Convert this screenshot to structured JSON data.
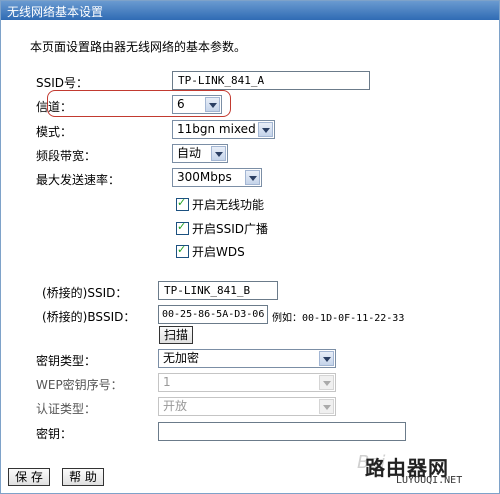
{
  "window": {
    "title": "无线网络基本设置"
  },
  "intro": "本页面设置路由器无线网络的基本参数。",
  "ssid": {
    "label": "SSID号：",
    "value": "TP-LINK_841_A"
  },
  "channel": {
    "label": "信道：",
    "value": "6"
  },
  "mode": {
    "label": "模式：",
    "value": "11bgn mixed"
  },
  "bandwidth": {
    "label": "频段带宽：",
    "value": "自动"
  },
  "max_rate": {
    "label": "最大发送速率：",
    "value": "300Mbps"
  },
  "options": {
    "wireless": "开启无线功能",
    "ssid_broadcast": "开启SSID广播",
    "wds": "开启WDS"
  },
  "bridge": {
    "ssid_label": "(桥接的)SSID：",
    "ssid_value": "TP-LINK_841_B",
    "bssid_label": "(桥接的)BSSID：",
    "bssid_value": "00-25-86-5A-D3-06",
    "bssid_example": "例如：00-1D-0F-11-22-33",
    "scan_button": "扫描"
  },
  "security": {
    "key_type_label": "密钥类型：",
    "key_type_value": "无加密",
    "wep_index_label": "WEP密钥序号：",
    "wep_index_value": "1",
    "auth_type_label": "认证类型：",
    "auth_type_value": "开放",
    "key_label": "密钥：",
    "key_value": ""
  },
  "footer": {
    "save": "保 存",
    "help": "帮 助"
  },
  "watermark": {
    "brand": "路由器网",
    "url": "LUYOUQI.NET",
    "baidu": "Bai"
  },
  "colors": {
    "titlebar": "#2f6bb4",
    "highlight": "#c23a30"
  }
}
